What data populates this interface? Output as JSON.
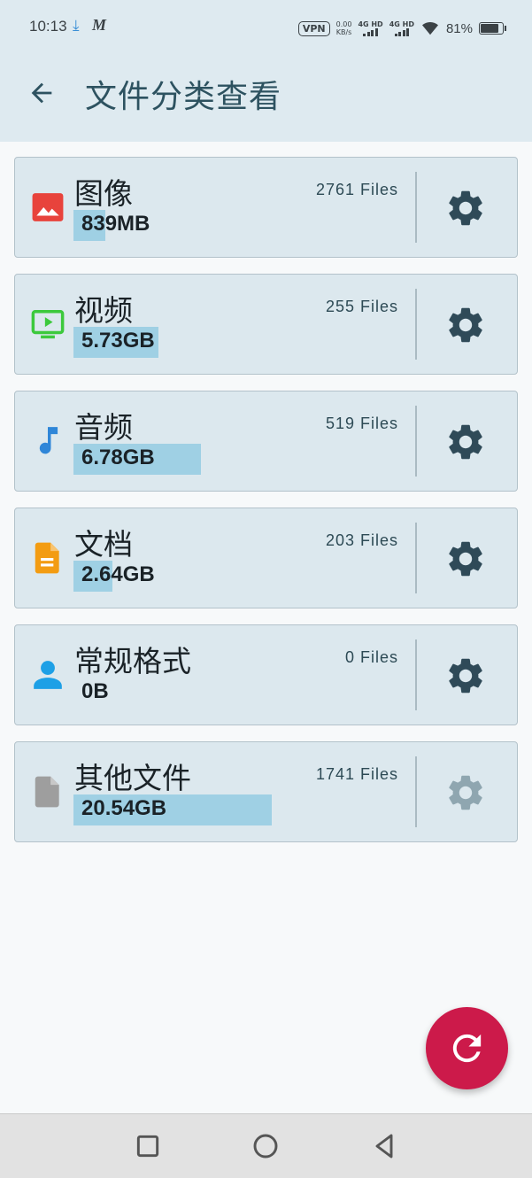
{
  "status_bar": {
    "time": "10:13",
    "download_icon": "download-icon",
    "app_icon_text": "M",
    "vpn": "VPN",
    "net_speed_value": "0.00",
    "net_speed_unit": "KB/s",
    "sim1": "4G HD",
    "sim2": "4G HD",
    "battery": "81%"
  },
  "app_bar": {
    "title": "文件分类查看",
    "back_icon": "arrow-left-icon"
  },
  "categories": [
    {
      "name": "图像",
      "size": "839MB",
      "count": "2761  Files",
      "usage_fraction": 0.08,
      "icon": "image-icon",
      "icon_color": "#e8433c"
    },
    {
      "name": "视频",
      "size": "5.73GB",
      "count": "255  Files",
      "usage_fraction": 0.24,
      "icon": "video-icon",
      "icon_color": "#3cc93c"
    },
    {
      "name": "音频",
      "size": "6.78GB",
      "count": "519  Files",
      "usage_fraction": 0.36,
      "icon": "music-note-icon",
      "icon_color": "#2f86d8"
    },
    {
      "name": "文档",
      "size": "2.64GB",
      "count": "203  Files",
      "usage_fraction": 0.11,
      "icon": "document-icon",
      "icon_color": "#f39c12"
    },
    {
      "name": "常规格式",
      "size": "0B",
      "count": "0  Files",
      "usage_fraction": 0,
      "icon": "person-icon",
      "icon_color": "#1ea0e6"
    },
    {
      "name": "其他文件",
      "size": "20.54GB",
      "count": "1741  Files",
      "usage_fraction": 0.56,
      "icon": "file-icon",
      "icon_color": "#9e9e9e"
    }
  ],
  "colors": {
    "gear_active": "#2f4a58",
    "gear_disabled": "#8fa6b0",
    "fab": "#cc1a4a",
    "usage_bar": "#9fd0e4"
  },
  "fab_icon": "refresh-icon",
  "nav": {
    "recent_icon": "square-icon",
    "home_icon": "circle-icon",
    "back_icon": "triangle-back-icon"
  }
}
